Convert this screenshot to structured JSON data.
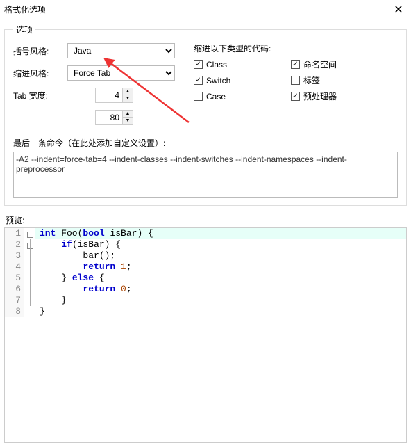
{
  "titlebar": {
    "title": "格式化选项",
    "close": "✕"
  },
  "options_legend": "选项",
  "labels": {
    "bracket_style": "括号风格:",
    "indent_style": "缩进风格:",
    "tab_width": "Tab 宽度:",
    "indent_types": "缩进以下类型的代码:",
    "last_cmd": "最后一条命令（在此处添加自定义设置）:"
  },
  "combos": {
    "bracket_style": "Java",
    "indent_style": "Force Tab"
  },
  "spinners": {
    "tab_width": "4",
    "wrap": "80"
  },
  "checks": {
    "class": {
      "label": "Class",
      "checked": true
    },
    "namespace": {
      "label": "命名空间",
      "checked": true
    },
    "switch": {
      "label": "Switch",
      "checked": true
    },
    "label_tag": {
      "label": "标签",
      "checked": false
    },
    "case": {
      "label": "Case",
      "checked": false
    },
    "preproc": {
      "label": "预处理器",
      "checked": true
    }
  },
  "cmd_text": "-A2 --indent=force-tab=4 --indent-classes --indent-switches --indent-namespaces --indent-preprocessor",
  "preview_label": "预览:",
  "code": [
    {
      "n": "1",
      "kw1": "int",
      "mid": " Foo(",
      "kw2": "bool",
      "rest": " isBar) {"
    },
    {
      "n": "2",
      "pre": "    ",
      "kw": "if",
      "rest": "(isBar) {"
    },
    {
      "n": "3",
      "text": "        bar();"
    },
    {
      "n": "4",
      "pre": "        ",
      "kw": "return",
      "sp": " ",
      "num": "1",
      "semi": ";"
    },
    {
      "n": "5",
      "pre": "    } ",
      "kw": "else",
      "rest": " {"
    },
    {
      "n": "6",
      "pre": "        ",
      "kw": "return",
      "sp": " ",
      "num": "0",
      "semi": ";"
    },
    {
      "n": "7",
      "text": "    }"
    },
    {
      "n": "8",
      "text": "}"
    }
  ]
}
